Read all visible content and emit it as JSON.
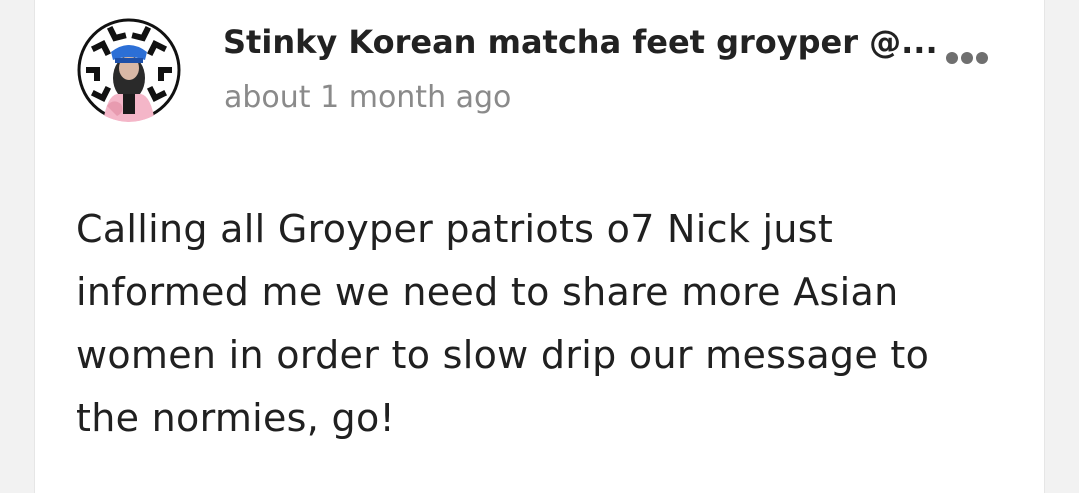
{
  "post": {
    "author_name": "Stinky Korean matcha feet groyper @...",
    "timestamp": "about 1 month ago",
    "body": "Calling all Groyper patriots o7 Nick just informed me we need to share more Asian women in order to slow drip our message to the normies, go!",
    "more_icon": "more-horizontal-icon"
  },
  "colors": {
    "background": "#f2f2f2",
    "card": "#ffffff",
    "author_text": "#222222",
    "timestamp_text": "#8a8a8a",
    "body_text": "#202020",
    "icon": "#6f6f6f"
  }
}
